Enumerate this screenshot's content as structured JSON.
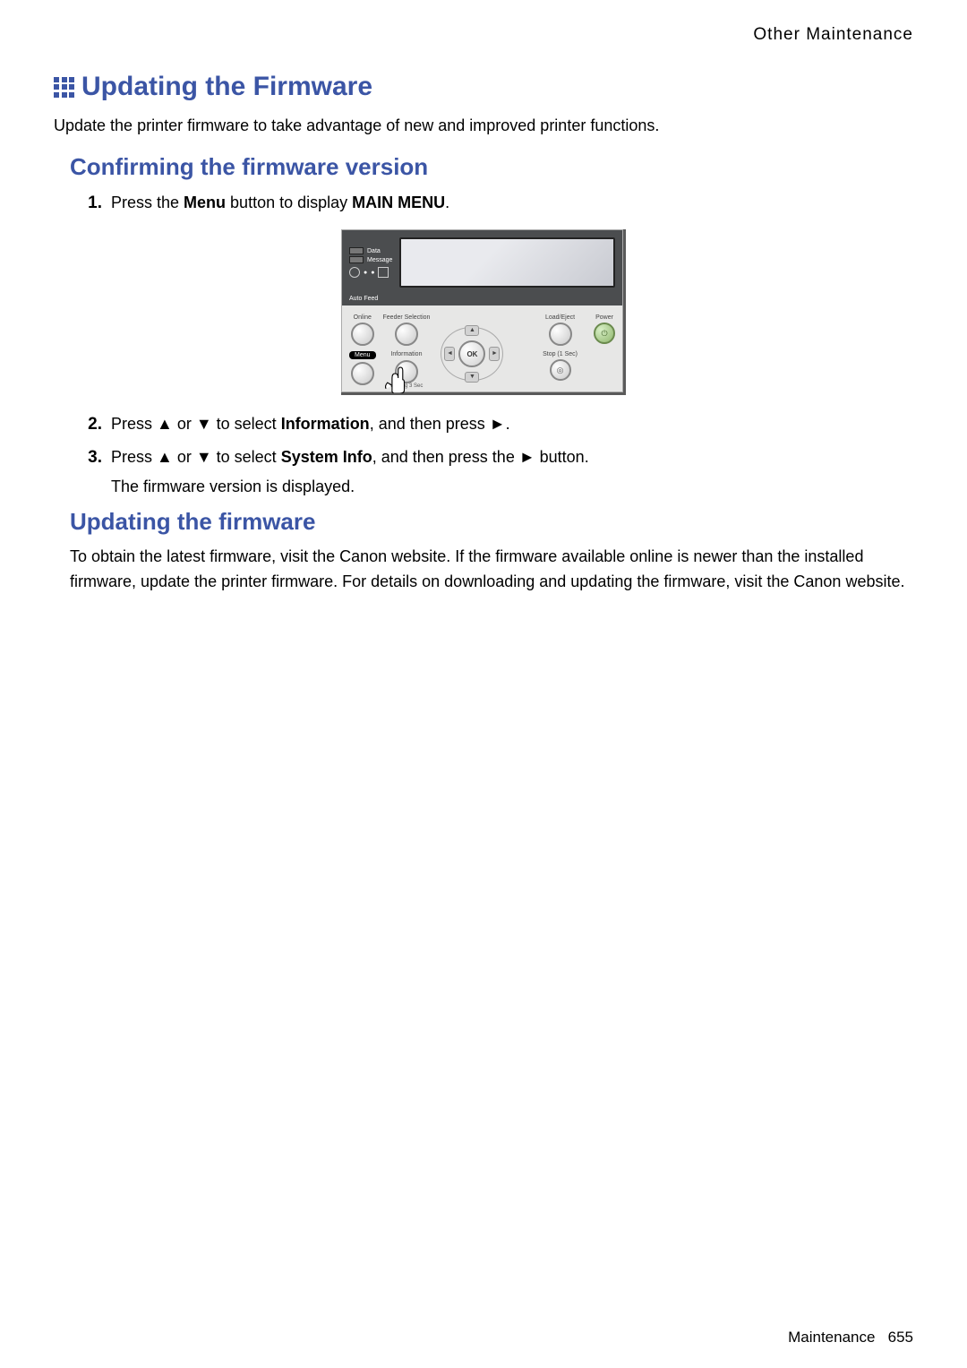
{
  "breadcrumb": "Other Maintenance",
  "h1": "Updating the Firmware",
  "intro": "Update the printer firmware to take advantage of new and improved printer functions.",
  "section1": {
    "heading": "Confirming the firmware version",
    "step1_a": "Press the ",
    "step1_b": "Menu",
    "step1_c": " button to display ",
    "step1_d": "MAIN MENU",
    "step1_e": ".",
    "step2_a": "Press ▲ or ▼ to select ",
    "step2_b": "Information",
    "step2_c": ", and then press ►.",
    "step3_a": "Press ▲ or ▼ to select ",
    "step3_b": "System Info",
    "step3_c": ", and then press the ► button.",
    "step3_sub": "The firmware version is displayed.",
    "num1": "1.",
    "num2": "2.",
    "num3": "3."
  },
  "panel": {
    "data_label": "Data",
    "message_label": "Message",
    "autofeed_label": "Auto Feed",
    "online": "Online",
    "feeder": "Feeder Selection",
    "menu": "Menu",
    "information": "Information",
    "ok": "OK",
    "load": "Load/Eject",
    "power": "Power",
    "stop": "Stop (1 Sec)",
    "wait": "Waiting 3 Sec"
  },
  "section2": {
    "heading": "Updating the firmware",
    "body": "To obtain the latest firmware, visit the Canon website. If the firmware available online is newer than the installed firmware, update the printer firmware. For details on downloading and updating the firmware, visit the Canon website."
  },
  "footer": {
    "section": "Maintenance",
    "page": "655"
  }
}
